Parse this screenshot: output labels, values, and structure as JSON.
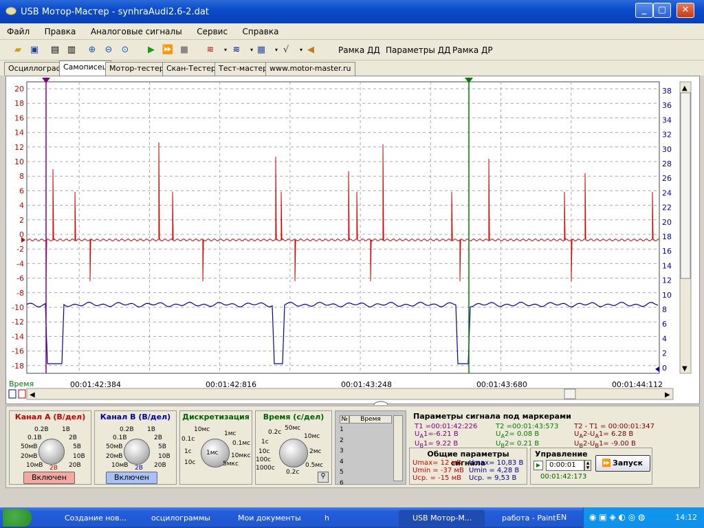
{
  "window": {
    "title": "USB Мотор-Мастер - synhraAudi2.6-2.dat",
    "btn_min": "_",
    "btn_max": "▢",
    "btn_close": "✕"
  },
  "menu": [
    "Файл",
    "Правка",
    "Аналоговые сигналы",
    "Сервис",
    "Справка"
  ],
  "toolbar": {
    "frame_dd": "Рамка ДД",
    "params_dd": "Параметры ДД",
    "frame_dr": "Рамка ДР"
  },
  "tabs": [
    "Осциллограф",
    "Самописец",
    "Мотор-тестер",
    "Скан-Тестер",
    "Тест-мастер",
    "www.motor-master.ru"
  ],
  "active_tab": 1,
  "scope": {
    "left_ticks": [
      "20",
      "18",
      "16",
      "14",
      "12",
      "10",
      "8",
      "6",
      "4",
      "2",
      "0",
      "-2",
      "-4",
      "-6",
      "-8",
      "-10",
      "-12",
      "-14",
      "-16",
      "-18"
    ],
    "right_ticks": [
      "38",
      "36",
      "34",
      "32",
      "30",
      "28",
      "26",
      "24",
      "22",
      "20",
      "18",
      "16",
      "14",
      "12",
      "10",
      "8",
      "6",
      "4",
      "2",
      "0"
    ],
    "time_label": "Время",
    "time_ticks": [
      "00:01:42:384",
      "00:01:42:816",
      "00:01:43:248",
      "00:01:43:680",
      "00:01:44:112"
    ],
    "marker1": "1",
    "marker2": "2",
    "color_a": "#cc0000",
    "color_b": "#0000aa",
    "color_m1": "#800080",
    "color_m2": "#008000"
  },
  "chA": {
    "title": "Канал А (В/дел)",
    "labels": [
      "0.2В",
      "1В",
      "0.1В",
      "2В",
      "50мВ",
      "5В",
      "20мВ",
      "10В",
      "10мВ",
      "20В",
      "2В"
    ],
    "btn": "Включен"
  },
  "chB": {
    "title": "Канал В (В/дел)",
    "labels": [
      "0.2В",
      "1В",
      "0.1В",
      "2В",
      "50мВ",
      "5В",
      "20мВ",
      "10В",
      "10мВ",
      "20В",
      "2В"
    ],
    "btn": "Включен"
  },
  "disc": {
    "title": "Дискретизация",
    "labels": [
      "10мс",
      "1мс",
      "0.1с",
      "0.1мс",
      "1с",
      "10мкс",
      "10с",
      "5мкс",
      "1мс"
    ]
  },
  "timebase": {
    "title": "Время (с/дел)",
    "labels": [
      "50мс",
      "0.2с",
      "10мс",
      "1с",
      "2мс",
      "10с",
      "100с",
      "0.5мс",
      "1000с",
      "0.2с"
    ]
  },
  "table": {
    "col_n": "№",
    "col_time": "Время",
    "rows": [
      "1",
      "2",
      "3",
      "4",
      "5",
      "6"
    ]
  },
  "params": {
    "title": "Параметры сигнала под маркерами",
    "t1": "T1 =00:01:42:226",
    "ua1": "U",
    "ua1s": "A",
    "ua1v": "1=-6.21 В",
    "ub1": "U",
    "ub1s": "B",
    "ub1v": "1= 9.22 В",
    "t2": "T2 =00:01:43:573",
    "ua2": "U",
    "ua2s": "A",
    "ua2v": "2= 0.08 В",
    "ub2": "U",
    "ub2s": "B",
    "ub2v": "2= 0.21 В",
    "dt": "T2 - T1 = 00:00:01:347",
    "dua": "U",
    "duas": "A",
    "duav": "2-U",
    "duas2": "A",
    "duav2": "1= 6.28 В",
    "dub": "U",
    "dubs": "B",
    "dubv": "2-U",
    "dubs2": "B",
    "dubv2": "1= -9.00 В"
  },
  "general": {
    "title": "Общие параметры сигнала",
    "a_max": "Umax= 12 мВ",
    "a_min": "Umin = -37 мВ",
    "a_avg": "Ucp. = -15 мВ",
    "b_max": "Umax= 10,83 В",
    "b_min": "Umin = 4,28 В",
    "b_avg": "Ucp. = 9,53 В"
  },
  "control": {
    "title": "Управление",
    "time_input": "0:00:01",
    "clock": "00:01:42:173",
    "run": "Запуск"
  },
  "taskbar": {
    "items": [
      "Создание нов...",
      "осцилограммы",
      "Мои документы",
      "h",
      "USB Мотор-М...",
      "работа - Paint"
    ],
    "lang": "EN",
    "clock": "14:12"
  }
}
